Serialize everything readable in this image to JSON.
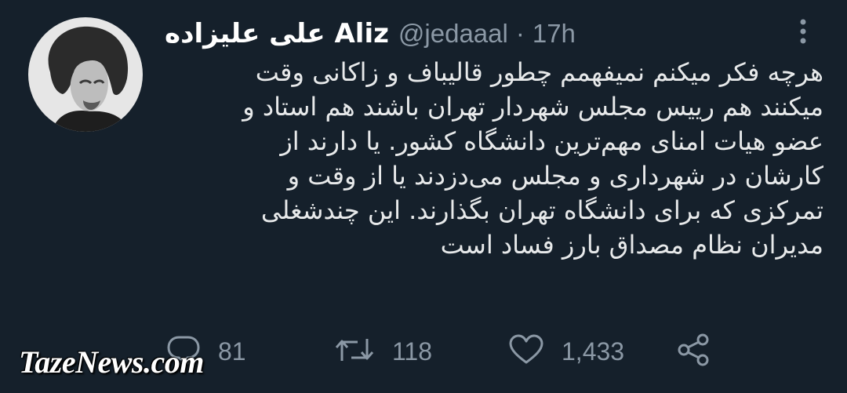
{
  "tweet": {
    "author_display": "علی علیزاده Aliz",
    "handle": "@jedaaal",
    "separator": "·",
    "time": "17h",
    "text_lines": [
      "هرچه فکر میکنم نمیفهمم چطور قالیباف و زاکانی وقت",
      "میکنند هم رییس مجلس شهردار تهران باشند هم استاد و",
      "عضو هیات امنای مهم‌ترین دانشگاه کشور. یا دارند از",
      "کارشان در شهرداری و مجلس می‌دزدند یا از وقت و",
      "تمرکزی که برای دانشگاه تهران بگذارند. این چندشغلی",
      "مدیران نظام مصداق بارز فساد است"
    ],
    "actions": {
      "replies": "81",
      "retweets": "118",
      "likes": "1,433"
    },
    "icons": [
      "more-vertical-icon",
      "reply-icon",
      "retweet-icon",
      "like-icon",
      "share-icon"
    ]
  },
  "watermark": "TazeNews.com",
  "colors": {
    "background": "#15202b",
    "text": "#e7e9ea",
    "secondary": "#8b98a5"
  }
}
